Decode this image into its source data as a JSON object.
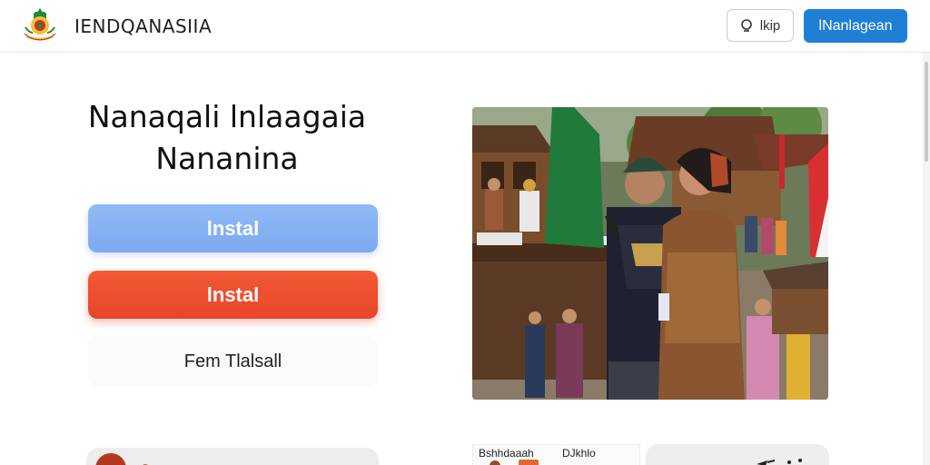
{
  "header": {
    "brand": "IENDQANASIIA",
    "help_label": "lkip",
    "login_label": "lNanlagean"
  },
  "hero": {
    "title_line1": "Nanaqali lnlaagaia",
    "title_line2": "Nananina",
    "primary_cta": "lnstal",
    "secondary_cta": "lnstal",
    "tertiary_link": "Fem Tlalsall"
  },
  "news": {
    "source": "Bshhdaaah",
    "date": "DJkhlo"
  },
  "colors": {
    "accent_blue": "#1f7fd6",
    "primary_cta": "#7daaf0",
    "secondary_cta": "#e8452a"
  },
  "icons": {
    "help": "search-icon",
    "logo": "emblem-logo"
  }
}
